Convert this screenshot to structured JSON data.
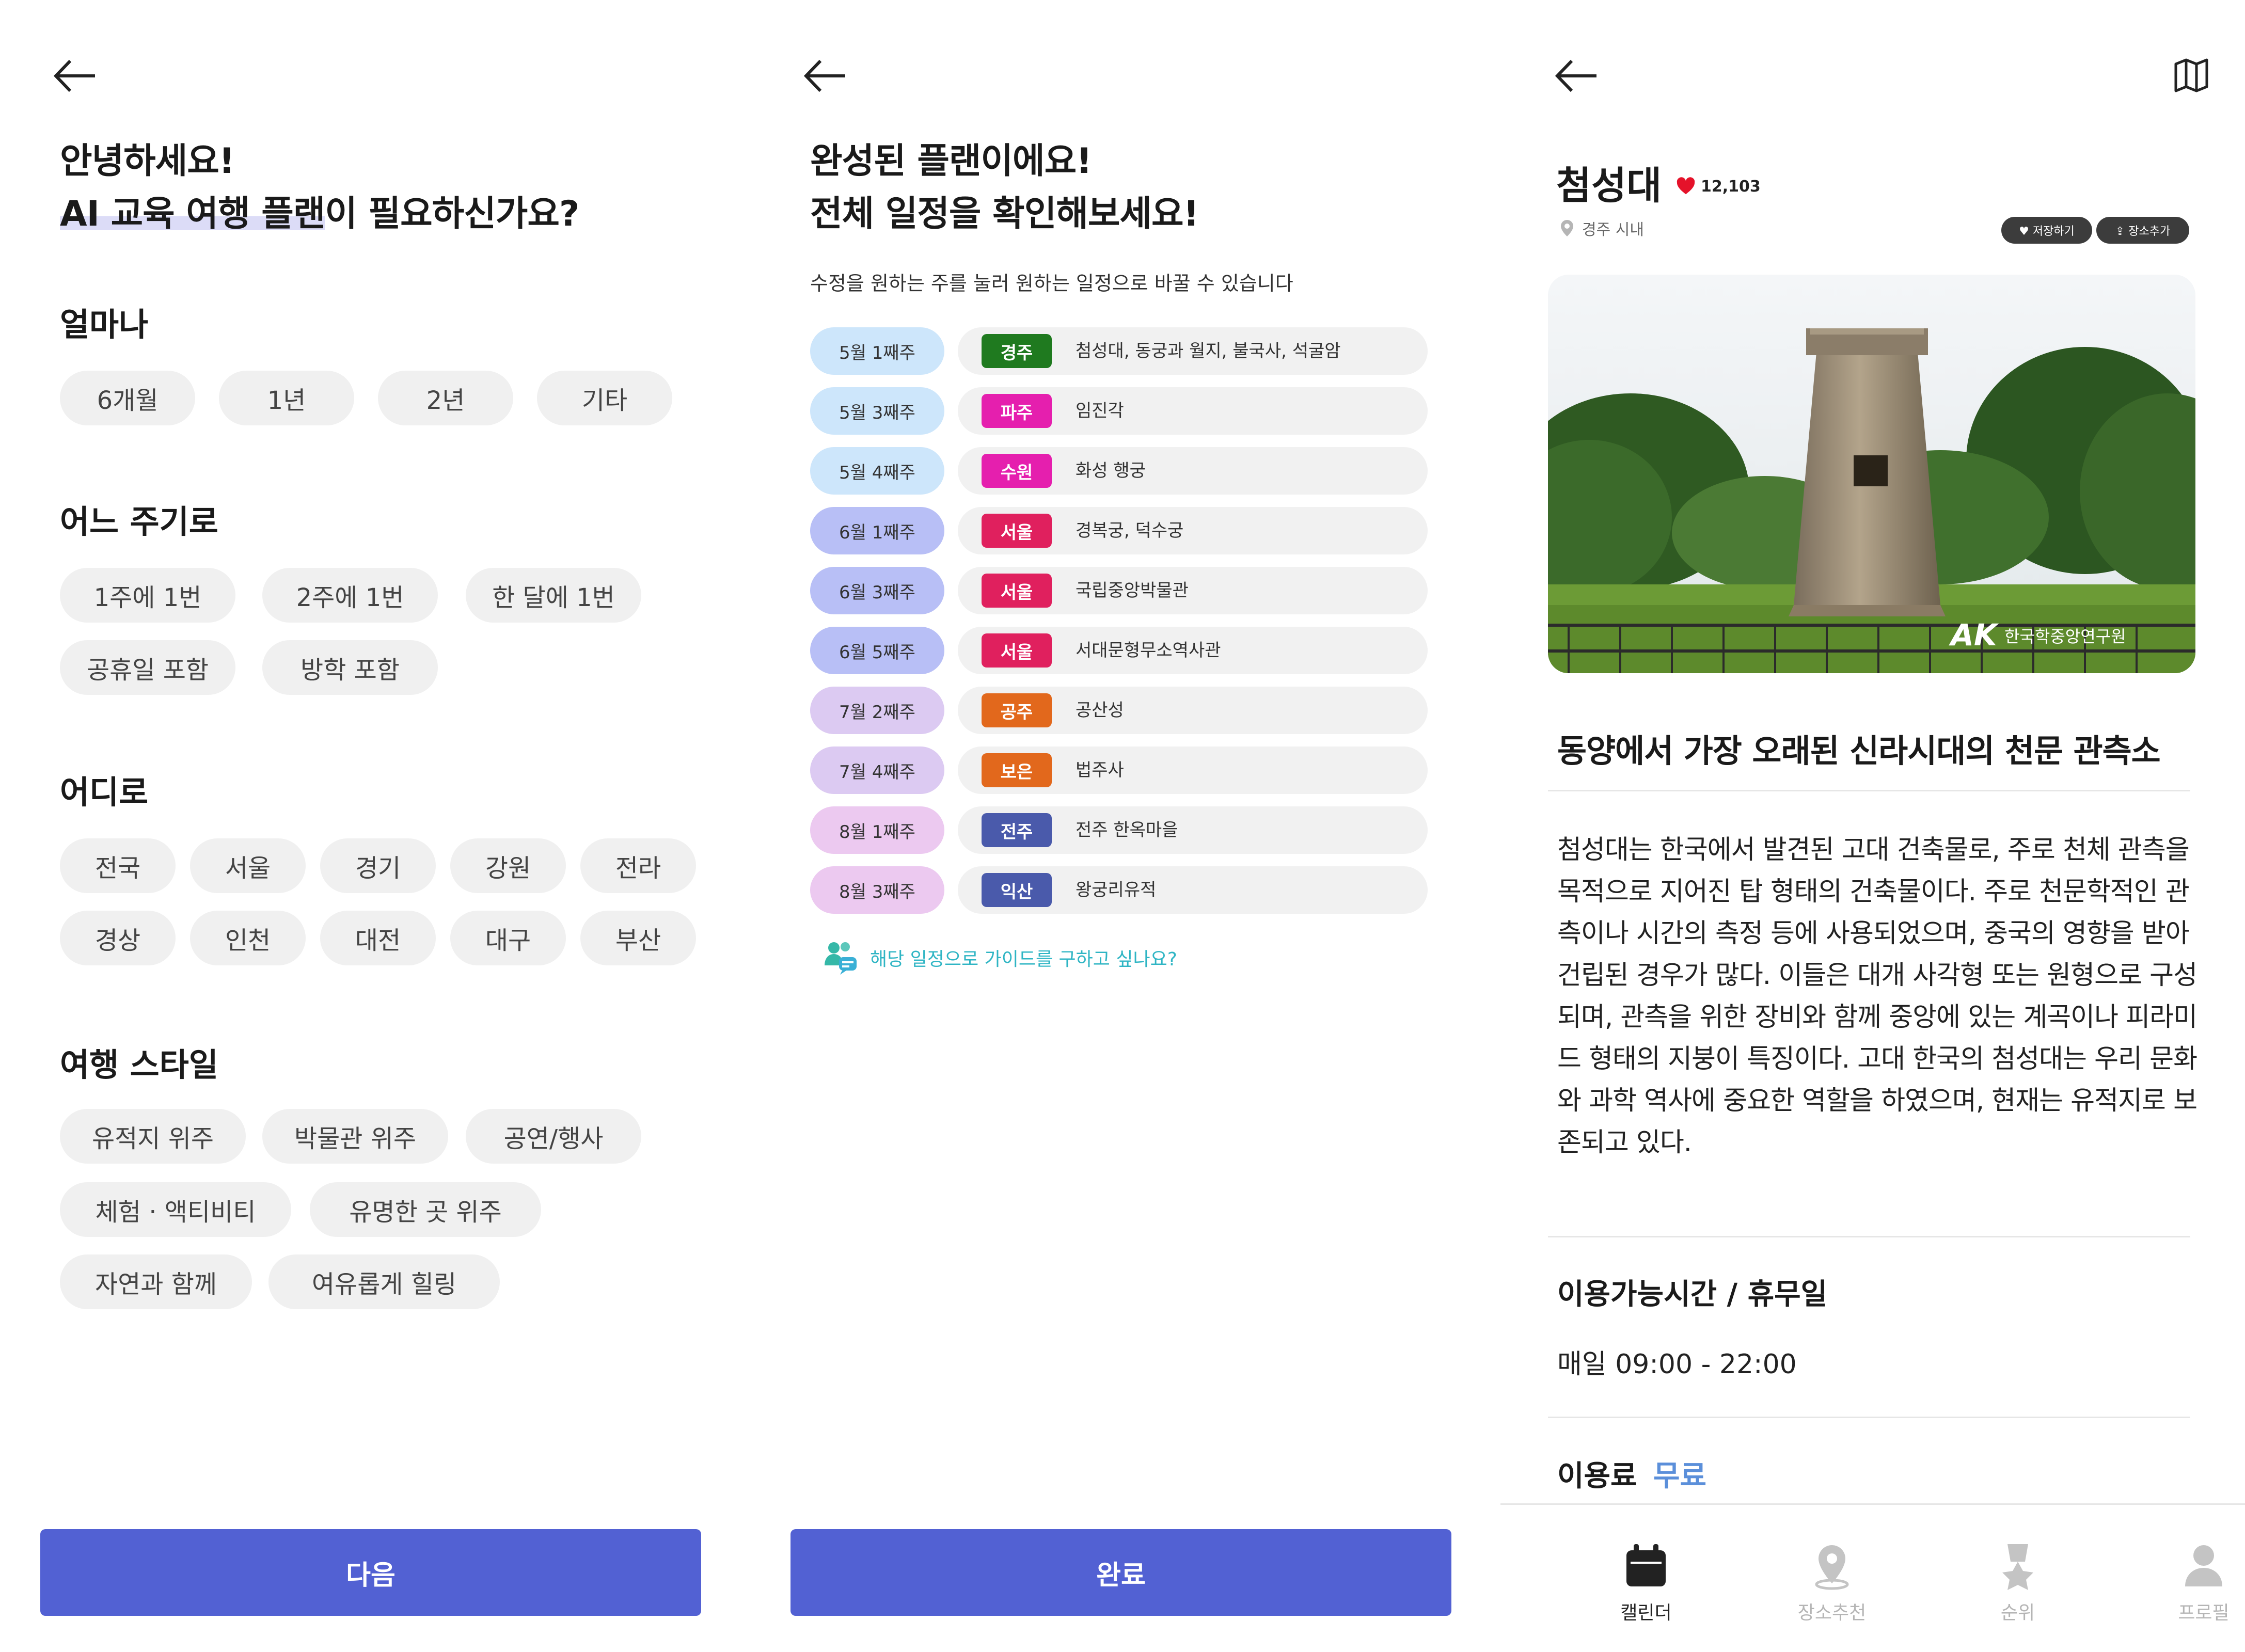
{
  "panel1": {
    "heading_line1": "안녕하세요!",
    "heading_hl": "AI 교육 여행 플랜",
    "heading_rest": "이 필요하신가요?",
    "sections": {
      "duration": {
        "title": "얼마나",
        "options": [
          "6개월",
          "1년",
          "2년",
          "기타"
        ]
      },
      "frequency": {
        "title": "어느 주기로",
        "options": [
          "1주에 1번",
          "2주에 1번",
          "한 달에 1번",
          "공휴일 포함",
          "방학 포함"
        ]
      },
      "region": {
        "title": "어디로",
        "options": [
          "전국",
          "서울",
          "경기",
          "강원",
          "전라",
          "경상",
          "인천",
          "대전",
          "대구",
          "부산"
        ]
      },
      "style": {
        "title": "여행 스타일",
        "options": [
          "유적지 위주",
          "박물관 위주",
          "공연/행사",
          "체험 · 액티비티",
          "유명한 곳 위주",
          "자연과 함께",
          "여유롭게 힐링"
        ]
      }
    },
    "next_label": "다음"
  },
  "panel2": {
    "heading_line1": "완성된 플랜이에요!",
    "heading_line2": "전체 일정을 확인해보세요!",
    "subtitle": "수정을 원하는 주를 눌러 원하는 일정으로 바꿀 수 있습니다",
    "rows": [
      {
        "week": "5월 1째주",
        "city": "경주",
        "places": "첨성대, 동궁과 월지, 불국사, 석굴암",
        "week_color": "#cde6fb",
        "city_color": "#1f7a1f"
      },
      {
        "week": "5월 3째주",
        "city": "파주",
        "places": "임진각",
        "week_color": "#cde6fb",
        "city_color": "#e51fae"
      },
      {
        "week": "5월 4째주",
        "city": "수원",
        "places": "화성 행궁",
        "week_color": "#cde6fb",
        "city_color": "#e51fae"
      },
      {
        "week": "6월 1째주",
        "city": "서울",
        "places": "경복궁, 덕수궁",
        "week_color": "#b8bff6",
        "city_color": "#e0205e"
      },
      {
        "week": "6월 3째주",
        "city": "서울",
        "places": "국립중앙박물관",
        "week_color": "#b8bff6",
        "city_color": "#e0205e"
      },
      {
        "week": "6월 5째주",
        "city": "서울",
        "places": "서대문형무소역사관",
        "week_color": "#b8bff6",
        "city_color": "#e0205e"
      },
      {
        "week": "7월 2째주",
        "city": "공주",
        "places": "공산성",
        "week_color": "#dccaf2",
        "city_color": "#e2681c"
      },
      {
        "week": "7월 4째주",
        "city": "보은",
        "places": "법주사",
        "week_color": "#dccaf2",
        "city_color": "#e2681c"
      },
      {
        "week": "8월 1째주",
        "city": "전주",
        "places": "전주 한옥마을",
        "week_color": "#ecc9f0",
        "city_color": "#4a5aab"
      },
      {
        "week": "8월 3째주",
        "city": "익산",
        "places": "왕궁리유적",
        "week_color": "#ecc9f0",
        "city_color": "#4a5aab"
      }
    ],
    "guide_text": "해당 일정으로 가이드를 구하고 싶나요?",
    "done_label": "완료"
  },
  "panel3": {
    "place_name": "첨성대",
    "likes": "12,103",
    "location": "경주 시내",
    "save_label": "♥ 저장하기",
    "add_label": "⇪ 장소추가",
    "photo_watermark": "한국학중앙연구원",
    "desc_title": "동양에서 가장 오래된 신라시대의 천문 관측소",
    "description": "첨성대는 한국에서 발견된 고대 건축물로, 주로 천체 관측을 목적으로 지어진 탑 형태의 건축물이다. 주로 천문학적인 관측이나 시간의 측정 등에 사용되었으며, 중국의 영향을 받아 건립된 경우가 많다. 이들은 대개 사각형 또는 원형으로 구성되며, 관측을 위한 장비와 함께 중앙에 있는 계곡이나 피라미드 형태의 지붕이 특징이다. 고대 한국의 첨성대는 우리 문화와 과학 역사에 중요한 역할을 하였으며, 현재는 유적지로 보존되고 있다.",
    "hours_title": "이용가능시간 / 휴무일",
    "hours": "매일 09:00 - 22:00",
    "fee_label": "이용료",
    "fee_value": "무료",
    "tabs": [
      {
        "label": "캘린더",
        "icon": "calendar-icon",
        "active": true
      },
      {
        "label": "장소추천",
        "icon": "location-pin-icon",
        "active": false
      },
      {
        "label": "순위",
        "icon": "ranking-medal-icon",
        "active": false
      },
      {
        "label": "프로필",
        "icon": "profile-icon",
        "active": false
      }
    ],
    "accent_color": "#5261d3"
  }
}
